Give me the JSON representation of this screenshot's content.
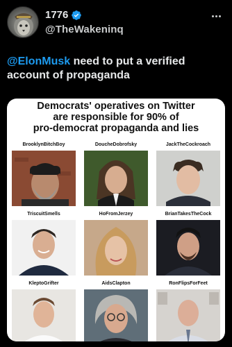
{
  "tweet": {
    "display_name": "1776",
    "handle": "@TheWakeninq",
    "verified": true,
    "mention": "@ElonMusk",
    "text_line1": "need to put a verified",
    "text_line2": "account of propaganda"
  },
  "media": {
    "title_line1": "Democrats' operatives on Twitter",
    "title_line2": "are responsible for 90% of",
    "title_line3": "pro-democrat propaganda and lies",
    "people": [
      {
        "label": "BrooklynBitchBoy",
        "photo": "bearded-man-beanie-photo"
      },
      {
        "label": "DoucheDobrofsky",
        "photo": "long-haired-man-photo"
      },
      {
        "label": "JackTheCockroach",
        "photo": "young-man-hoodie-photo"
      },
      {
        "label": "TriscuitSmells",
        "photo": "smiling-man-photo"
      },
      {
        "label": "HoFromJerzey",
        "photo": "blonde-woman-photo"
      },
      {
        "label": "BrianTakesTheCock",
        "photo": "man-dark-background-photo"
      },
      {
        "label": "KleptoGrifter",
        "photo": "man-white-shirt-photo"
      },
      {
        "label": "AidsClapton",
        "photo": "gray-haired-man-glasses-photo"
      },
      {
        "label": "RonFlipsForFeet",
        "photo": "bald-man-suit-photo"
      }
    ]
  },
  "colors": {
    "background": "#000000",
    "mention": "#1d9bf0",
    "verified": "#1d9bf0"
  }
}
